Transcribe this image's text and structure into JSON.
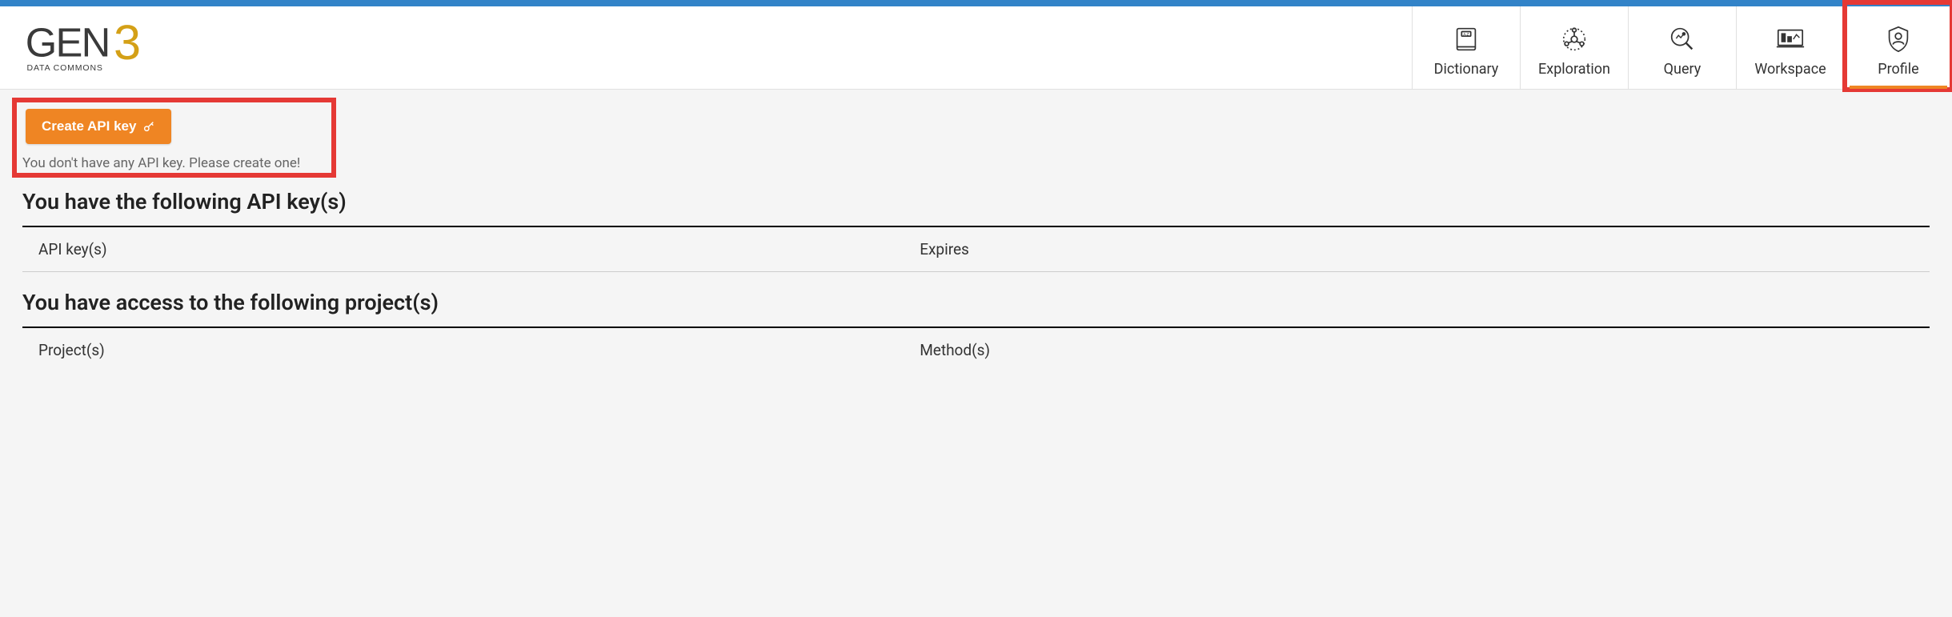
{
  "brand": {
    "name": "GEN3",
    "tagline": "DATA COMMONS"
  },
  "nav": {
    "items": [
      {
        "label": "Dictionary"
      },
      {
        "label": "Exploration"
      },
      {
        "label": "Query"
      },
      {
        "label": "Workspace"
      },
      {
        "label": "Profile"
      }
    ]
  },
  "api": {
    "create_button": "Create API key",
    "empty_message": "You don't have any API key. Please create one!"
  },
  "sections": {
    "api_keys_heading": "You have the following API key(s)",
    "api_keys_col1": "API key(s)",
    "api_keys_col2": "Expires",
    "projects_heading": "You have access to the following project(s)",
    "projects_col1": "Project(s)",
    "projects_col2": "Method(s)"
  }
}
